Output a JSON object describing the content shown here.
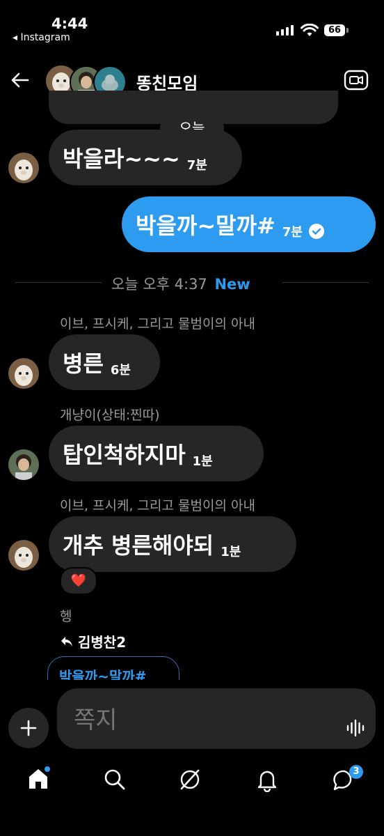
{
  "status_bar": {
    "time": "4:44",
    "back_app": "◂ Instagram",
    "battery": "66"
  },
  "header": {
    "title": "똥친모임"
  },
  "messages": {
    "top_partial_bubble": "",
    "date_pill": "오늘",
    "m1": {
      "text": "박을라~~~",
      "time": "7분"
    },
    "m2": {
      "text": "박을까~말까#",
      "time": "7분"
    },
    "divider": {
      "label": "오늘 오후 4:37",
      "new": "New"
    },
    "m3": {
      "sender": "이브, 프시케, 그리고 물범이의 아내",
      "text": "병른",
      "time": "6분"
    },
    "m4": {
      "sender": "개냥이(상태:찐따)",
      "text": "탑인척하지마",
      "time": "1분"
    },
    "m5": {
      "sender": "이브, 프시케, 그리고 물범이의 아내",
      "text": "개추 병른해야되",
      "time": "1분",
      "reaction": "❤️"
    },
    "m6": {
      "sender": "헹",
      "reply_to": "김병찬2",
      "quoted": "박을까~말까#"
    }
  },
  "composer": {
    "placeholder": "쪽지"
  },
  "bottom_nav": {
    "messages_badge": "3"
  },
  "colors": {
    "accent": "#2d9cf0",
    "bubble": "#262626",
    "background": "#000000"
  }
}
